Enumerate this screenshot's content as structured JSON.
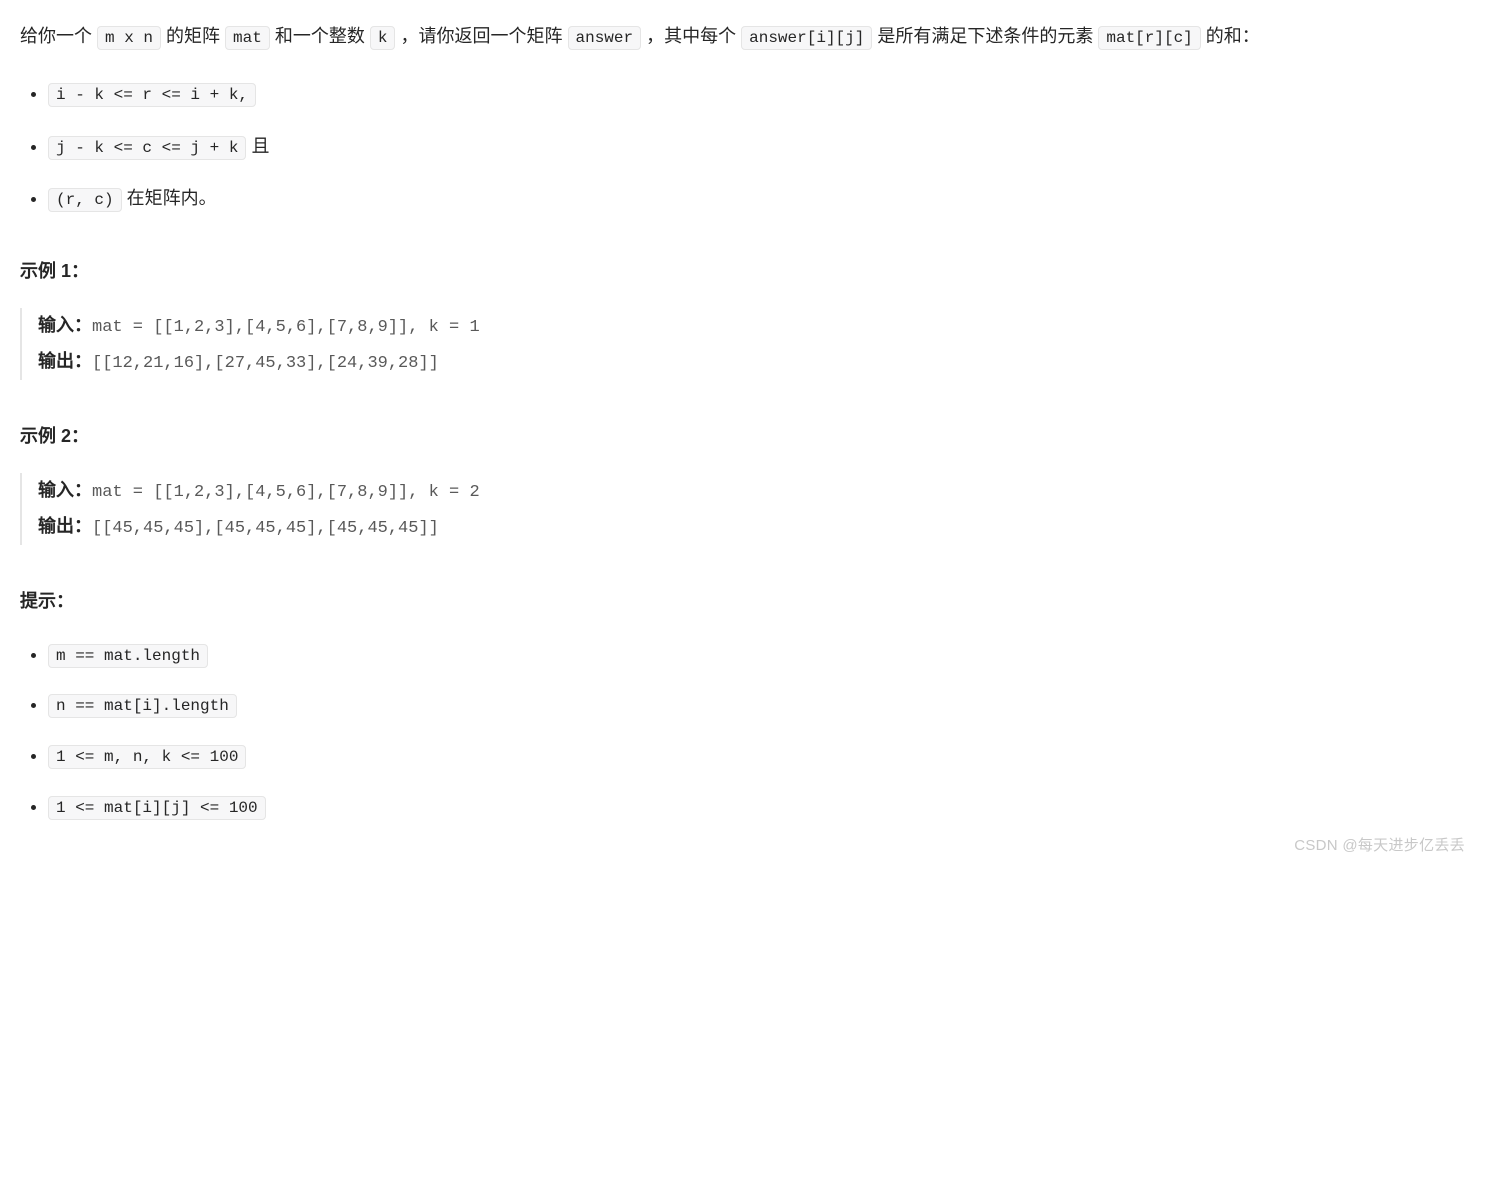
{
  "description": {
    "part1": "给你一个 ",
    "code1": "m x n",
    "part2": " 的矩阵 ",
    "code2": "mat",
    "part3": " 和一个整数 ",
    "code3": "k",
    "part4": " ，请你返回一个矩阵 ",
    "code4": "answer",
    "part5": " ，其中每个 ",
    "code5": "answer[i][j]",
    "part6": " 是所有满足下述条件的元素 ",
    "code6": "mat[r][c]",
    "part7": " 的和："
  },
  "conditions": [
    {
      "code": "i - k <= r <= i + k,",
      "suffix": ""
    },
    {
      "code": "j - k <= c <= j + k",
      "suffix": " 且"
    },
    {
      "code": "(r, c)",
      "suffix": " 在矩阵内。"
    }
  ],
  "example1": {
    "title": "示例 1：",
    "input_label": "输入：",
    "input_value": "mat = [[1,2,3],[4,5,6],[7,8,9]], k = 1",
    "output_label": "输出：",
    "output_value": "[[12,21,16],[27,45,33],[24,39,28]]"
  },
  "example2": {
    "title": "示例 2：",
    "input_label": "输入：",
    "input_value": "mat = [[1,2,3],[4,5,6],[7,8,9]], k = 2",
    "output_label": "输出：",
    "output_value": "[[45,45,45],[45,45,45],[45,45,45]]"
  },
  "hints": {
    "title": "提示：",
    "items": [
      "m == mat.length",
      "n == mat[i].length",
      "1 <= m, n, k <= 100",
      "1 <= mat[i][j] <= 100"
    ]
  },
  "watermark": "CSDN @每天进步亿丢丢"
}
